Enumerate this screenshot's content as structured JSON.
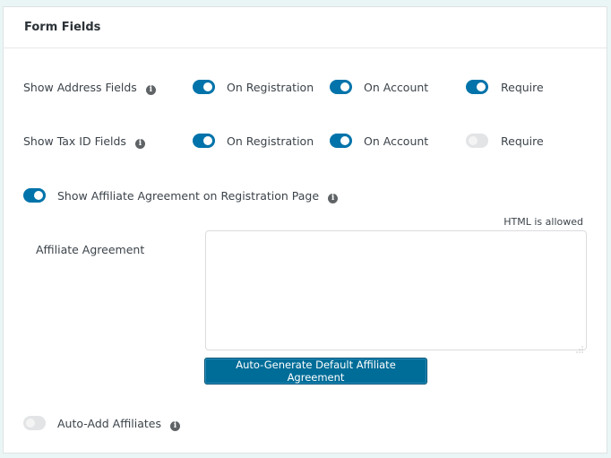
{
  "panel": {
    "title": "Form Fields"
  },
  "rows": [
    {
      "label": "Show Address Fields",
      "options": [
        {
          "label": "On Registration",
          "enabled": true
        },
        {
          "label": "On Account",
          "enabled": true
        },
        {
          "label": "Require",
          "enabled": true
        }
      ]
    },
    {
      "label": "Show Tax ID Fields",
      "options": [
        {
          "label": "On Registration",
          "enabled": true
        },
        {
          "label": "On Account",
          "enabled": true
        },
        {
          "label": "Require",
          "enabled": false
        }
      ]
    }
  ],
  "affiliate_agreement_toggle": {
    "label": "Show Affiliate Agreement on Registration Page",
    "enabled": true
  },
  "affiliate_agreement": {
    "label": "Affiliate Agreement",
    "hint": "HTML is allowed",
    "value": "",
    "button_label": "Auto-Generate Default Affiliate Agreement"
  },
  "auto_add_affiliates": {
    "label": "Auto-Add Affiliates",
    "enabled": false
  },
  "icons": {
    "info": "i"
  },
  "colors": {
    "accent": "#0073aa",
    "toggle_off": "#e2e4e6",
    "background": "#eaf6f6"
  }
}
